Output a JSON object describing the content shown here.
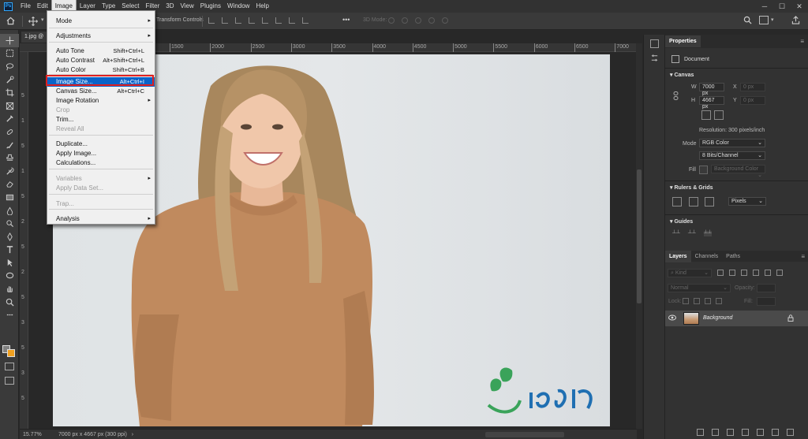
{
  "menubar": {
    "items": [
      "File",
      "Edit",
      "Image",
      "Layer",
      "Type",
      "Select",
      "Filter",
      "3D",
      "View",
      "Plugins",
      "Window",
      "Help"
    ],
    "active": "Image",
    "window_controls": [
      "─",
      "☐",
      "✕"
    ]
  },
  "options_bar": {
    "transform_controls": "Transform Controls",
    "mode_3d": "3D Mode:"
  },
  "document": {
    "tab_label": "1.jpg @",
    "zoom": "15.77%",
    "status_info": "7000 px x 4667 px (300 ppi)"
  },
  "rulers": {
    "top": [
      "1500",
      "2000",
      "2500",
      "3000",
      "3500",
      "4000",
      "4500",
      "5000",
      "5500",
      "6000",
      "6500",
      "7000"
    ],
    "left": [
      "5",
      "1",
      "5",
      "1",
      "5",
      "2",
      "5",
      "2",
      "5",
      "3",
      "5",
      "3",
      "5"
    ]
  },
  "image_menu": {
    "items": [
      {
        "label": "Mode",
        "submenu": true
      },
      {
        "label": "Adjustments",
        "submenu": true
      },
      {
        "label": "Auto Tone",
        "shortcut": "Shift+Ctrl+L"
      },
      {
        "label": "Auto Contrast",
        "shortcut": "Alt+Shift+Ctrl+L"
      },
      {
        "label": "Auto Color",
        "shortcut": "Shift+Ctrl+B"
      },
      {
        "label": "Image Size...",
        "shortcut": "Alt+Ctrl+I",
        "highlighted": true
      },
      {
        "label": "Canvas Size...",
        "shortcut": "Alt+Ctrl+C"
      },
      {
        "label": "Image Rotation",
        "submenu": true
      },
      {
        "label": "Crop",
        "disabled": true
      },
      {
        "label": "Trim..."
      },
      {
        "label": "Reveal All",
        "disabled": true
      },
      {
        "label": "Duplicate..."
      },
      {
        "label": "Apply Image..."
      },
      {
        "label": "Calculations..."
      },
      {
        "label": "Variables",
        "disabled": true,
        "submenu": true
      },
      {
        "label": "Apply Data Set...",
        "disabled": true
      },
      {
        "label": "Trap...",
        "disabled": true
      },
      {
        "label": "Analysis",
        "submenu": true
      }
    ]
  },
  "properties": {
    "tab": "Properties",
    "document_label": "Document",
    "canvas_section": "Canvas",
    "w_label": "W",
    "h_label": "H",
    "width": "7000 px",
    "height": "4667 px",
    "x_label": "X",
    "y_label": "Y",
    "x_placeholder": "0 px",
    "y_placeholder": "0 px",
    "resolution": "Resolution: 300 pixels/inch",
    "mode_label": "Mode",
    "mode_value": "RGB Color",
    "bit_depth": "8 Bits/Channel",
    "fill_label": "Fill",
    "fill_value": "Background Color",
    "rulers_grids": "Rulers & Grids",
    "units": "Pixels",
    "guides": "Guides"
  },
  "layers": {
    "tabs": [
      "Layers",
      "Channels",
      "Paths"
    ],
    "kind_placeholder": "Kind",
    "blend_mode": "Normal",
    "opacity_label": "Opacity:",
    "lock_label": "Lock:",
    "fill_label": "Fill:",
    "layer_name": "Background"
  },
  "colors": {
    "accent_highlight": "#0a63c9",
    "outline_red": "#e02020",
    "foreground_swatch": "#808080",
    "background_swatch": "#f0a020",
    "logo_green": "#3aa35a",
    "logo_blue": "#1f6fb2"
  }
}
